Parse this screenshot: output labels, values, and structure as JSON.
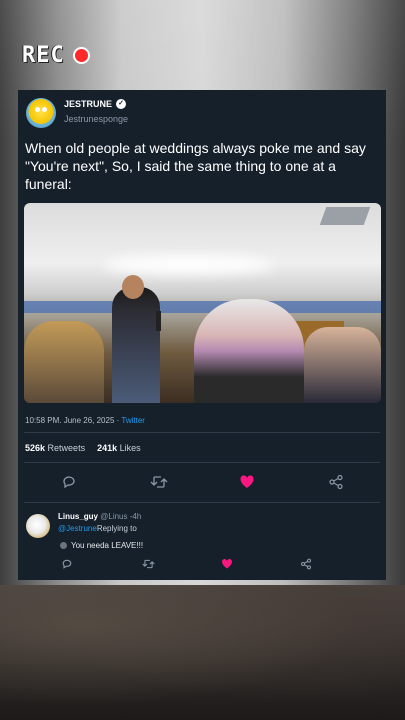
{
  "overlay": {
    "rec_label": "REC",
    "rec_dot_color": "#ff2a2a"
  },
  "tweet": {
    "display_name": "JESTRUNE",
    "verified_glyph": "✓",
    "handle": "Jestrunesponge",
    "text": "When old people at weddings always poke me and say \"You're next\", So, I said the same thing to one at a funeral:",
    "timestamp": "10:58 PM. June 26, 2025",
    "separator": " · ",
    "source": "Twitter",
    "retweets_count": "526k",
    "retweets_label": "Retweets",
    "likes_count": "241k",
    "likes_label": "Likes",
    "actions": {
      "reply_icon": "reply-icon",
      "retweet_icon": "retweet-icon",
      "like_icon": "heart-icon",
      "share_icon": "share-icon"
    }
  },
  "reply": {
    "user": "Linus_guy",
    "handle": "@Linus",
    "time": "-4h",
    "mention": "@Jestrune",
    "replying_label": "Replying to",
    "text": "You needa LEAVE!!!"
  },
  "colors": {
    "card_bg": "#15202b",
    "like": "#f91880",
    "link": "#1d9bf0"
  }
}
